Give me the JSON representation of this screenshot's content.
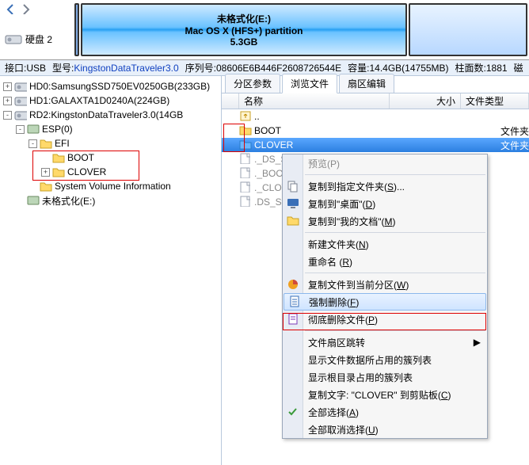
{
  "disk_label": "硬盘 2",
  "partition_main": {
    "line1": "未格式化(E:)",
    "line2": "Mac OS X (HFS+) partition",
    "line3": "5.3GB"
  },
  "infobar": {
    "interface": "接口:USB",
    "model_label": "型号:",
    "model": "KingstonDataTraveler3.0",
    "serial_label": "序列号:",
    "serial": "08606E6B446F2608726544E",
    "capacity": "容量:14.4GB(14755MB)",
    "cylinders": "柱面数:1881",
    "trail": "磁"
  },
  "tree": [
    {
      "exp": "+",
      "iconType": "hdd",
      "label": "HD0:SamsungSSD750EV0250GB(233GB)",
      "indent": 0
    },
    {
      "exp": "+",
      "iconType": "hdd",
      "label": "HD1:GALAXTA1D0240A(224GB)",
      "indent": 0
    },
    {
      "exp": "-",
      "iconType": "hdd",
      "label": "RD2:KingstonDataTraveler3.0(14GB",
      "indent": 0
    },
    {
      "exp": "-",
      "iconType": "part",
      "label": "ESP(0)",
      "indent": 1
    },
    {
      "exp": "-",
      "iconType": "folder",
      "label": "EFI",
      "indent": 2
    },
    {
      "exp": "",
      "iconType": "folder",
      "label": "BOOT",
      "indent": 3
    },
    {
      "exp": "+",
      "iconType": "folder",
      "label": "CLOVER",
      "indent": 3
    },
    {
      "exp": "",
      "iconType": "folder",
      "label": "System Volume Information",
      "indent": 2
    },
    {
      "exp": "",
      "iconType": "part",
      "label": "未格式化(E:)",
      "indent": 1
    }
  ],
  "tabs": [
    "分区参数",
    "浏览文件",
    "扇区编辑"
  ],
  "active_tab": 1,
  "cols": {
    "name": "名称",
    "size": "大小",
    "type": "文件类型"
  },
  "files": [
    {
      "iconType": "up",
      "name": "..",
      "selected": false
    },
    {
      "iconType": "folder",
      "name": "BOOT",
      "type": "文件夹",
      "selected": false
    },
    {
      "iconType": "folder",
      "name": "CLOVER",
      "type": "文件夹",
      "selected": true
    },
    {
      "iconType": "file",
      "name": "._DS_Stor",
      "dim": true
    },
    {
      "iconType": "file",
      "name": "._BOOT",
      "dim": true
    },
    {
      "iconType": "file",
      "name": "._CLOVER",
      "dim": true
    },
    {
      "iconType": "file",
      "name": ".DS_Store",
      "dim": true
    }
  ],
  "ctx": {
    "header": "预览(P)",
    "items": [
      {
        "icon": "copy",
        "text": "复制到指定文件夹(S)..."
      },
      {
        "icon": "desktop",
        "text": "复制到\"桌面\"(D)"
      },
      {
        "icon": "folder",
        "text": "复制到\"我的文档\"(M)"
      },
      {
        "sep": true
      },
      {
        "text": "新建文件夹(N)"
      },
      {
        "text": "重命名 (R)"
      },
      {
        "sep": true
      },
      {
        "icon": "pie",
        "text": "复制文件到当前分区(W)"
      },
      {
        "icon": "doc",
        "text": "强制删除(F)",
        "hover": true
      },
      {
        "icon": "shred",
        "text": "彻底删除文件(P)"
      },
      {
        "sep": true
      },
      {
        "text": "文件扇区跳转",
        "arrow": "▶"
      },
      {
        "text": "显示文件数据所占用的簇列表"
      },
      {
        "text": "显示根目录占用的簇列表"
      },
      {
        "text": "复制文字: \"CLOVER\" 到剪贴板(C)"
      },
      {
        "icon": "check",
        "text": "全部选择(A)"
      },
      {
        "text": "全部取消选择(U)"
      }
    ]
  }
}
